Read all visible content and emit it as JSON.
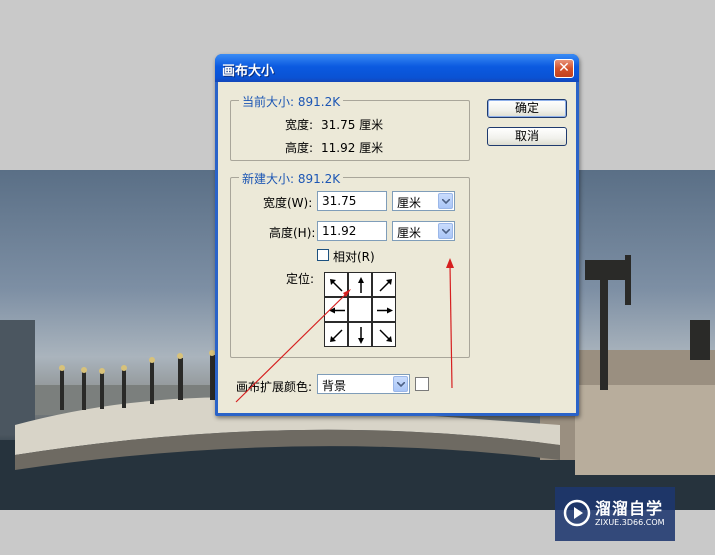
{
  "dialog": {
    "title": "画布大小",
    "close_icon": "close-icon",
    "ok_label": "确定",
    "cancel_label": "取消"
  },
  "current_size": {
    "legend": "当前大小: 891.2K",
    "width_label": "宽度:",
    "width_value": "31.75 厘米",
    "height_label": "高度:",
    "height_value": "11.92 厘米"
  },
  "new_size": {
    "legend": "新建大小: 891.2K",
    "width_label": "宽度(W):",
    "width_value": "31.75",
    "width_unit": "厘米",
    "height_label": "高度(H):",
    "height_value": "11.92",
    "height_unit": "厘米",
    "relative_label": "相对(R)",
    "relative_checked": false,
    "anchor_label": "定位:",
    "anchor_cells": [
      "arrow-up-left-icon",
      "arrow-up-icon",
      "arrow-up-right-icon",
      "arrow-left-icon",
      "anchor-center",
      "arrow-right-icon",
      "arrow-down-left-icon",
      "arrow-down-icon",
      "arrow-down-right-icon"
    ]
  },
  "extension_color": {
    "label": "画布扩展颜色:",
    "value": "背景",
    "swatch_color": "#ffffff"
  },
  "watermark": {
    "name": "溜溜自学",
    "url": "ZIXUE.3D66.COM"
  },
  "colors": {
    "titlebar": "#0a52d4",
    "annotation_arrow": "#d62020",
    "group_legend": "#1c56b4"
  }
}
